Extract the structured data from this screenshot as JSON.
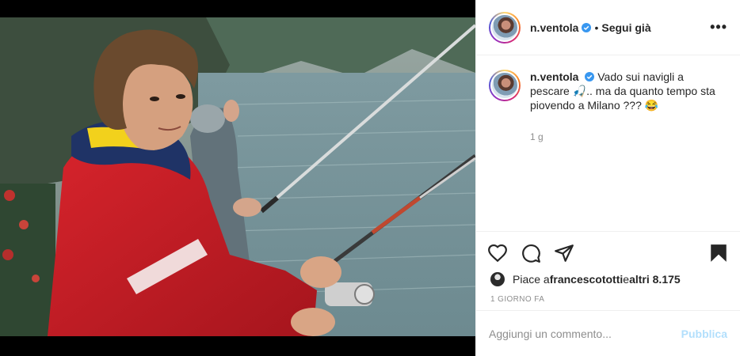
{
  "post": {
    "author": "n.ventola",
    "follow_label": "Segui già",
    "more_label": "•••",
    "separator": "•"
  },
  "caption": {
    "author": "n.ventola",
    "text": "Vado sui navigli a pescare 🎣.. ma da quanto tempo sta piovendo a Milano ??? 😂",
    "age": "1 g"
  },
  "actions": {
    "like": "heart-icon",
    "comment": "comment-icon",
    "share": "paper-plane-icon",
    "save": "bookmark-icon"
  },
  "likes": {
    "prefix": "Piace a ",
    "user": "francescototti",
    "middle": " e ",
    "others": "altri 8.175"
  },
  "date": "1 GIORNO FA",
  "comment_box": {
    "placeholder": "Aggiungi un commento...",
    "publish_label": "Pubblica"
  },
  "colors": {
    "verified": "#3897f0",
    "publish_disabled": "#b2dffc",
    "muted": "#8e8e8e"
  }
}
